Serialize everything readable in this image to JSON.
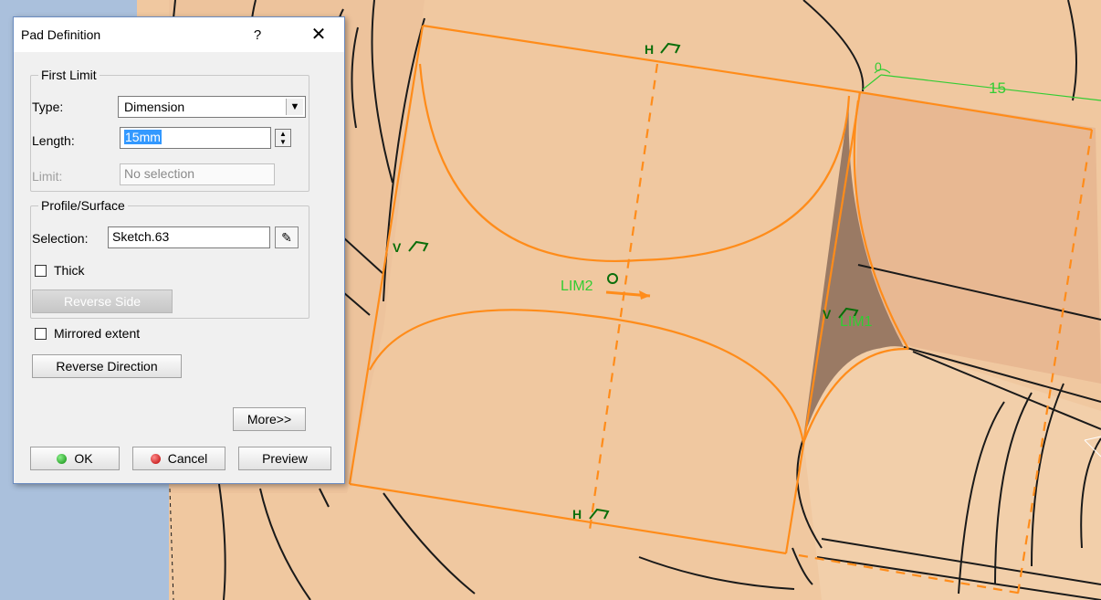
{
  "dialog": {
    "title": "Pad Definition",
    "help_glyph": "?",
    "close_glyph": "✕",
    "first_limit": {
      "legend": "First Limit",
      "type_label": "Type:",
      "type_value": "Dimension",
      "length_label": "Length:",
      "length_value": "15mm",
      "limit_label": "Limit:",
      "limit_value": "No selection"
    },
    "profile_surface": {
      "legend": "Profile/Surface",
      "selection_label": "Selection:",
      "selection_value": "Sketch.63",
      "thick_label": "Thick",
      "reverse_side_label": "Reverse Side"
    },
    "mirrored_extent_label": "Mirrored extent",
    "reverse_direction_label": "Reverse Direction",
    "more_label": "More>>",
    "ok_label": "OK",
    "cancel_label": "Cancel",
    "preview_label": "Preview"
  },
  "viewport": {
    "constraint_top": "H",
    "constraint_bottom": "H",
    "constraint_left": "V",
    "constraint_right": "V",
    "lim1_label": "LIM1",
    "lim2_label": "LIM2",
    "dimension_value": "15",
    "angle_value": "0",
    "colors": {
      "surface": "#f0c8a0",
      "profile": "#ff8c1a",
      "constraint": "#0a6e0a",
      "annotation": "#33cc33",
      "background": "#aac0dc"
    }
  }
}
